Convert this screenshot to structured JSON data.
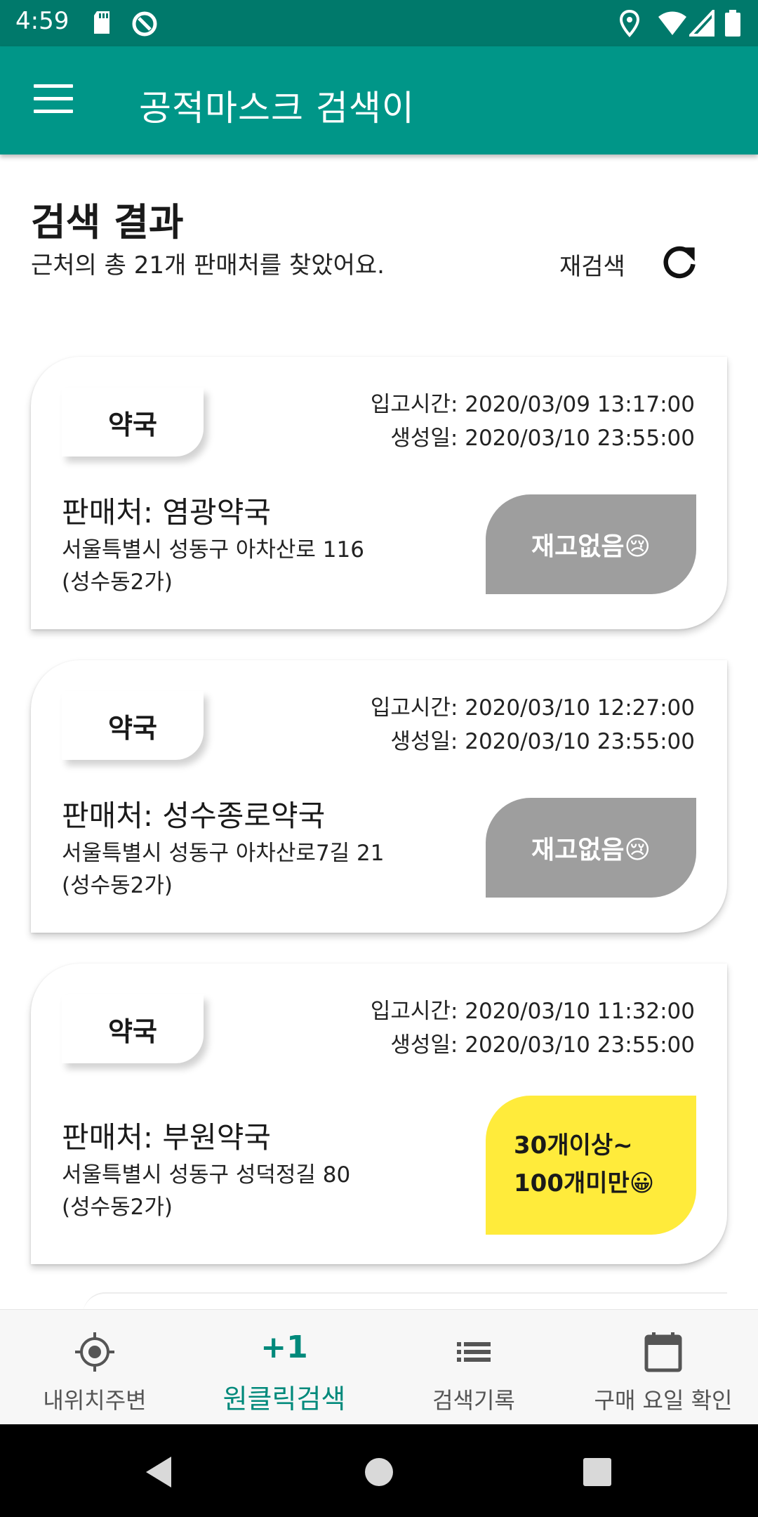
{
  "status": {
    "time": "4:59"
  },
  "appbar": {
    "title": "공적마스크 검색이"
  },
  "results": {
    "title": "검색 결과",
    "subtitle": "근처의 총 21개 판매처를 찾았어요.",
    "refresh_label": "재검색"
  },
  "cards": [
    {
      "type": "약국",
      "stock_time": "입고시간: 2020/03/09 13:17:00",
      "created": "생성일: 2020/03/10 23:55:00",
      "name": "판매처: 염광약국",
      "address": "서울특별시 성동구 아차산로 116 (성수동2가)",
      "stock_label": "재고없음😢",
      "stock_color": "#9e9e9e"
    },
    {
      "type": "약국",
      "stock_time": "입고시간: 2020/03/10 12:27:00",
      "created": "생성일: 2020/03/10 23:55:00",
      "name": "판매처: 성수종로약국",
      "address": "서울특별시 성동구 아차산로7길 21 (성수동2가)",
      "stock_label": "재고없음😢",
      "stock_color": "#9e9e9e"
    },
    {
      "type": "약국",
      "stock_time": "입고시간: 2020/03/10 11:32:00",
      "created": "생성일: 2020/03/10 23:55:00",
      "name": "판매처: 부원약국",
      "address": "서울특별시 성동구 성덕정길 80 (성수동2가)",
      "stock_label_line1": "30개이상~",
      "stock_label_line2": "100개미만😀",
      "stock_color": "#ffeb3b"
    }
  ],
  "bottom_nav": [
    {
      "label": "내위치주변",
      "icon": "crosshair-icon"
    },
    {
      "label": "원클릭검색",
      "icon_text": "+1",
      "active": true
    },
    {
      "label": "검색기록",
      "icon": "list-icon"
    },
    {
      "label": "구매 요일 확인",
      "icon": "calendar-icon"
    }
  ],
  "colors": {
    "primary": "#009688",
    "primary_dark": "#00796b",
    "accent": "#00897b"
  }
}
